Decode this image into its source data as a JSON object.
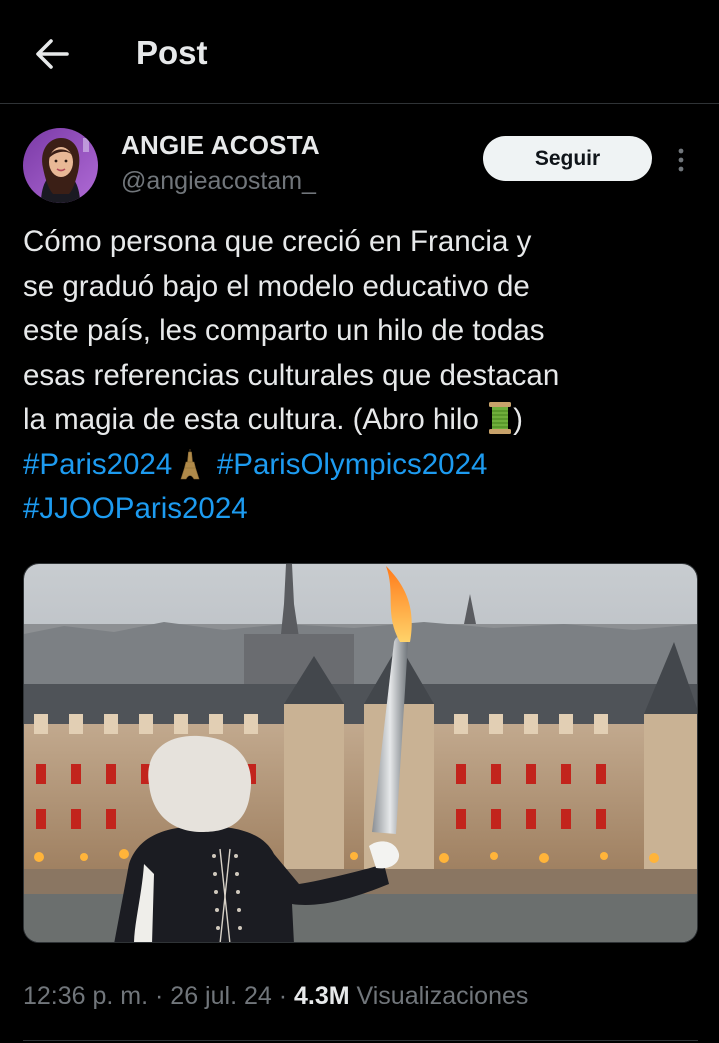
{
  "header": {
    "title": "Post"
  },
  "author": {
    "name": "ANGIE ACOSTA",
    "handle": "@angieacostam_"
  },
  "follow_label": "Seguir",
  "tweet": {
    "lines": [
      "Cómo persona que creció en Francia y",
      "se graduó bajo el modelo educativo de",
      "este país, les comparto un hilo de todas",
      "esas referencias culturales que destacan"
    ],
    "last_line_text": "la magia de esta cultura. (Abro hilo ",
    "last_line_close": ")",
    "hashtags": [
      "#Paris2024",
      "#ParisOlympics2024",
      "#JJOOParis2024"
    ]
  },
  "meta": {
    "time": "12:36 p. m.",
    "sep1": " · ",
    "date": "26 jul. 24",
    "sep2": " · ",
    "views": "4.3M",
    "views_label": " Visualizaciones"
  },
  "icons": {
    "back": "arrow-left-icon",
    "more": "more-vertical-icon",
    "thread": "spool-of-thread-emoji",
    "eiffel": "eiffel-tower-emoji"
  },
  "colors": {
    "background": "#000000",
    "text": "#e7e9ea",
    "secondary": "#71767b",
    "link": "#1d9bf0",
    "follow_bg": "#eff3f4"
  }
}
